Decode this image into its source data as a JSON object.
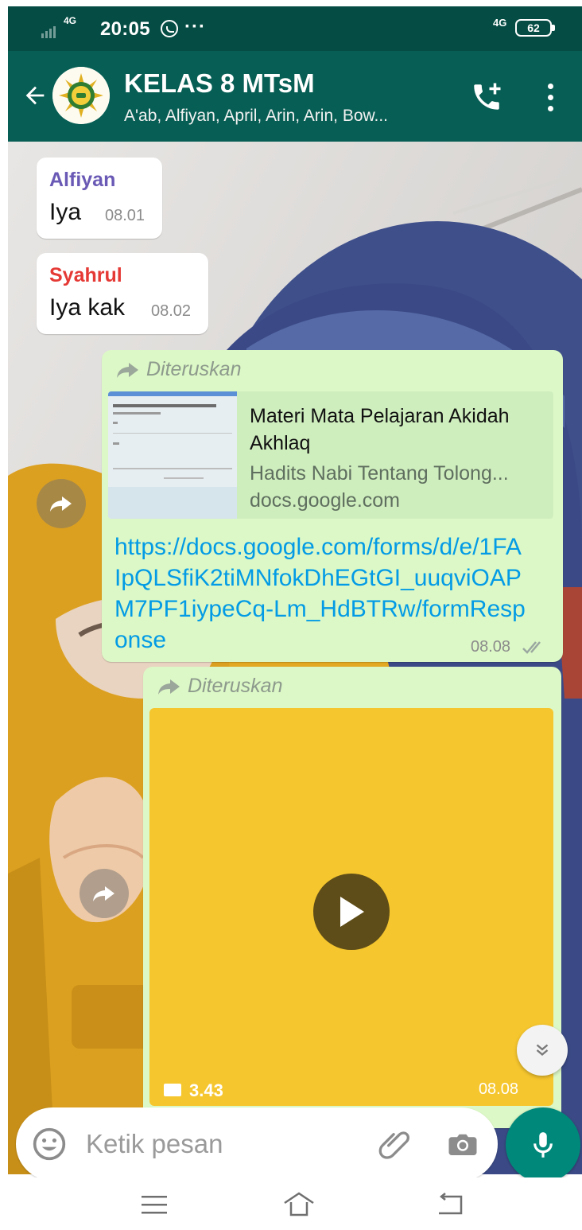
{
  "status_bar": {
    "network_label": "4G",
    "time": "20:05",
    "more_indicator": "···",
    "data_label": "4G",
    "battery": "62"
  },
  "header": {
    "title": "KELAS 8 MTsM",
    "subtitle": "A'ab, Alfiyan, April, Arin, Arin, Bow...",
    "theme_color": "#075e54"
  },
  "messages": [
    {
      "sender": "Alfiyan",
      "sender_color": "#6a5ab5",
      "text": "Iya",
      "time": "08.01"
    },
    {
      "sender": "Syahrul",
      "sender_color": "#e53935",
      "text": "Iya kak",
      "time": "08.02"
    },
    {
      "forwarded_label": "Diteruskan",
      "link_title": "Materi Mata Pelajaran Akidah Akhlaq",
      "link_description": "Hadits Nabi Tentang Tolong...",
      "link_domain": "docs.google.com",
      "url": "https://docs.google.com/forms/d/e/1FAIpQLSfiK2tiMNfokDhEGtGI_uuqviOAPM7PF1iypeCq-Lm_HdBTRw/formResponse",
      "time": "08.08"
    },
    {
      "forwarded_label": "Diteruskan",
      "video_duration": "3.43",
      "time": "08.08"
    }
  ],
  "composer": {
    "placeholder": "Ketik pesan"
  },
  "icons": {
    "back": "arrow-left-icon",
    "call": "add-call-icon",
    "menu": "more-vertical-icon",
    "emoji": "smiley-icon",
    "attach": "paperclip-icon",
    "camera": "camera-icon",
    "mic": "microphone-icon",
    "forward": "share-arrow-icon",
    "play": "play-icon",
    "scroll": "double-chevron-down-icon"
  },
  "colors": {
    "accent": "#00897b",
    "outgoing_bubble": "#dcf8c6",
    "link": "#039be5"
  }
}
